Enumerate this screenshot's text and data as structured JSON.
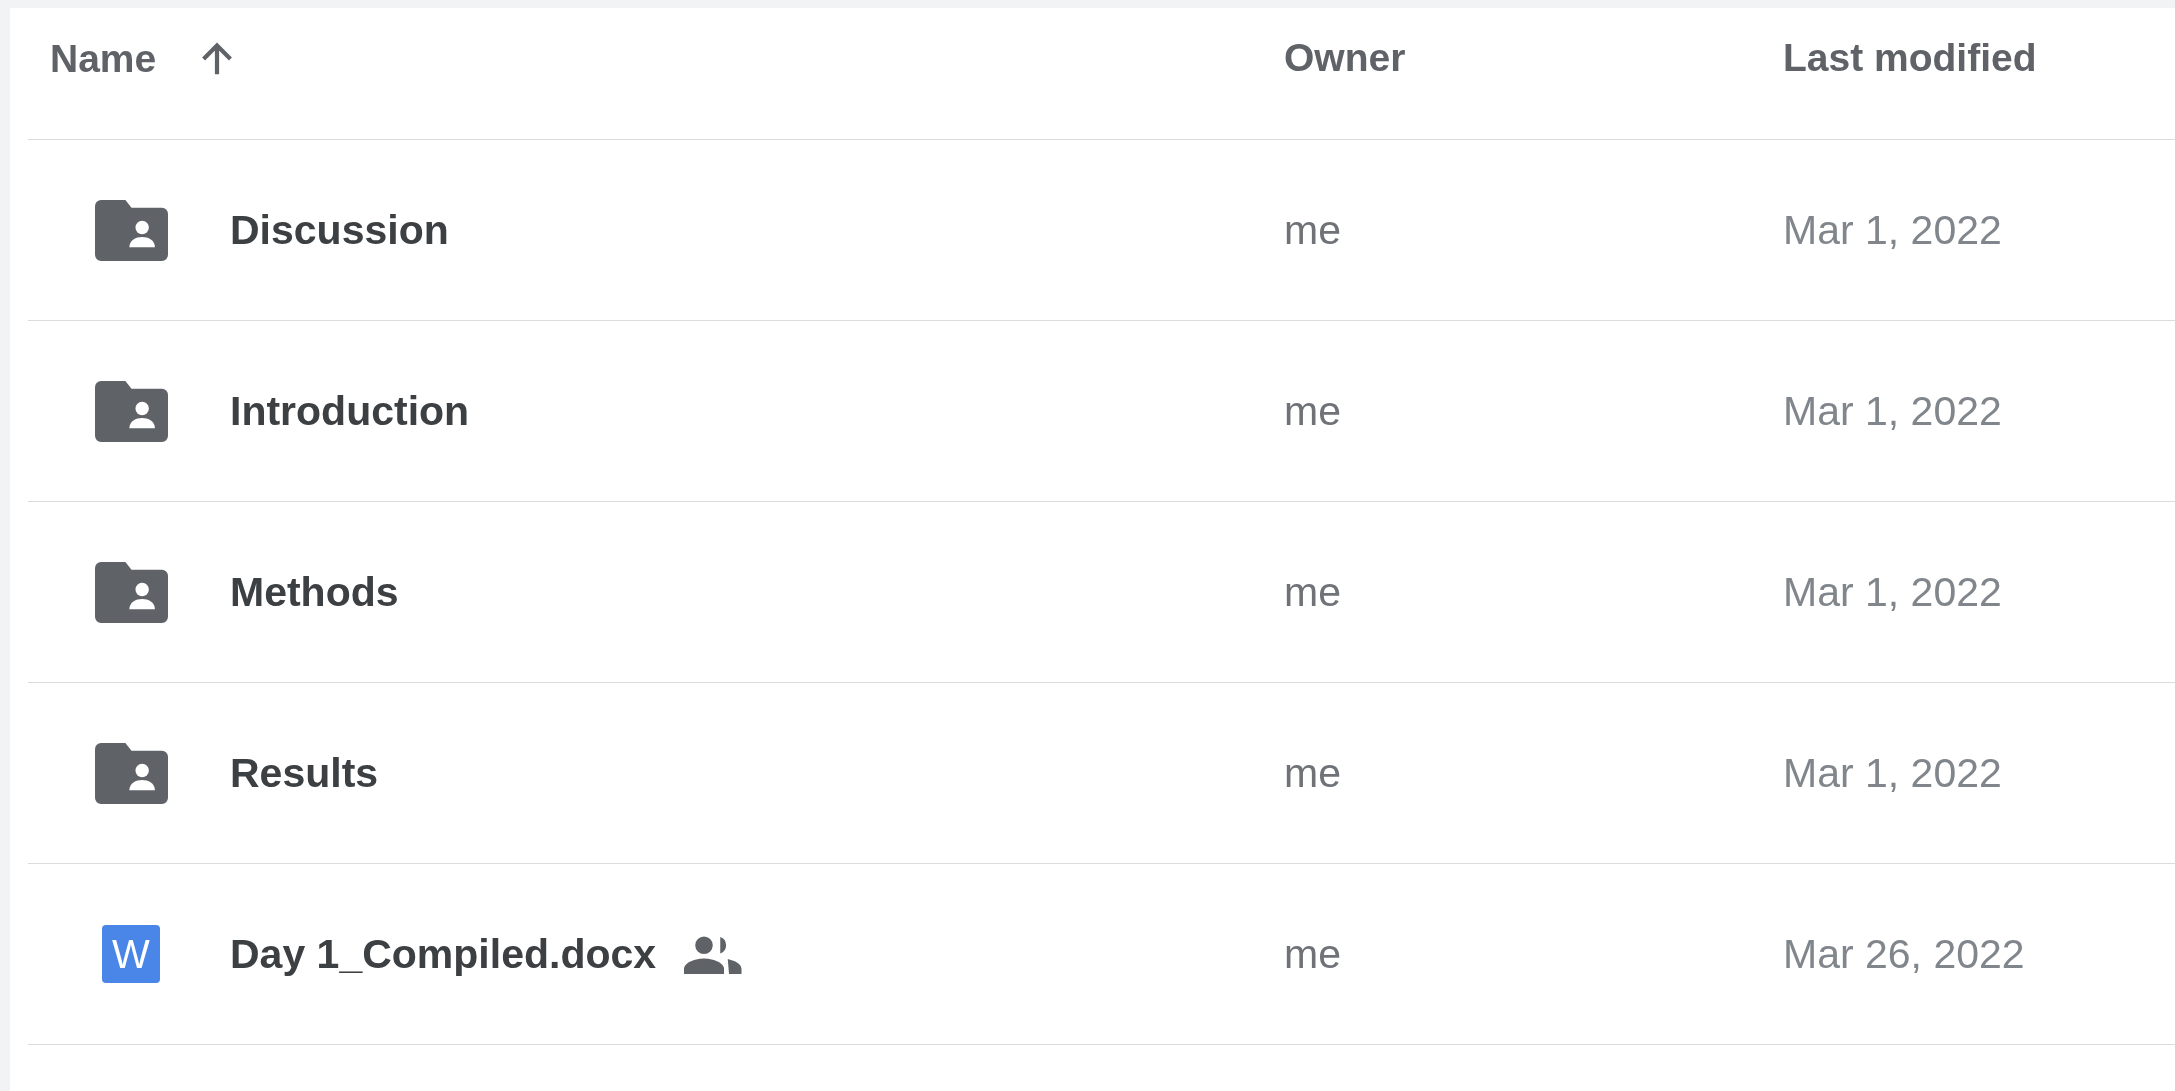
{
  "table": {
    "columns": [
      {
        "label": "Name",
        "sorted_ascending": true
      },
      {
        "label": "Owner",
        "sorted_ascending": false
      },
      {
        "label": "Last modified",
        "sorted_ascending": false
      }
    ],
    "rows": [
      {
        "kind": "folder",
        "name": "Discussion",
        "shared": false,
        "owner": "me",
        "modified": "Mar 1, 2022"
      },
      {
        "kind": "folder",
        "name": "Introduction",
        "shared": false,
        "owner": "me",
        "modified": "Mar 1, 2022"
      },
      {
        "kind": "folder",
        "name": "Methods",
        "shared": false,
        "owner": "me",
        "modified": "Mar 1, 2022"
      },
      {
        "kind": "folder",
        "name": "Results",
        "shared": false,
        "owner": "me",
        "modified": "Mar 1, 2022"
      },
      {
        "kind": "document",
        "icon_letter": "W",
        "name": "Day 1_Compiled.docx",
        "shared": true,
        "owner": "me",
        "modified": "Mar 26, 2022"
      }
    ]
  }
}
